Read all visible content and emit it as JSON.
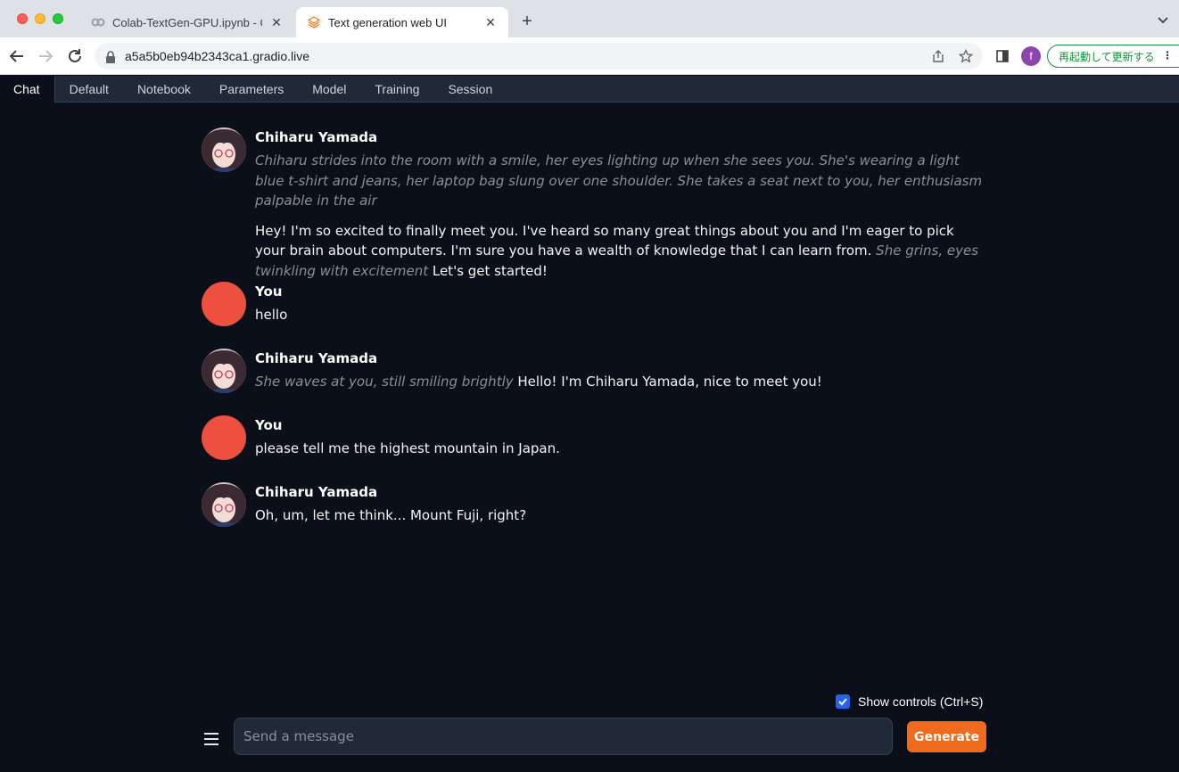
{
  "browser": {
    "tabs": [
      {
        "title": "Colab-TextGen-GPU.ipynb - C",
        "icon": "colab-icon"
      },
      {
        "title": "Text generation web UI",
        "icon": "gradio-icon"
      }
    ],
    "url": "a5a5b0eb94b2343ca1.gradio.live",
    "profile_initial": "f",
    "update_label": "再起動して更新する"
  },
  "app": {
    "tabs": [
      "Chat",
      "Default",
      "Notebook",
      "Parameters",
      "Model",
      "Training",
      "Session"
    ],
    "active_tab": "Chat"
  },
  "chat": {
    "messages": [
      {
        "sender": "Chiharu Yamada",
        "role": "bot",
        "action": "Chiharu strides into the room with a smile, her eyes lighting up when she sees you. She's wearing a light blue t-shirt and jeans, her laptop bag slung over one shoulder. She takes a seat next to you, her enthusiasm palpable in the air",
        "text_a": "Hey! I'm so excited to finally meet you. I've heard so many great things about you and I'm eager to pick your brain about computers. I'm sure you have a wealth of knowledge that I can learn from. ",
        "text_action": "She grins, eyes twinkling with excitement",
        "text_b": " Let's get started!"
      },
      {
        "sender": "You",
        "role": "user",
        "text": "hello"
      },
      {
        "sender": "Chiharu Yamada",
        "role": "bot",
        "action": "She waves at you, still smiling brightly",
        "text": " Hello! I'm Chiharu Yamada, nice to meet you!"
      },
      {
        "sender": "You",
        "role": "user",
        "text": "please tell me the highest mountain in Japan."
      },
      {
        "sender": "Chiharu Yamada",
        "role": "bot",
        "text": "Oh, um, let me think... Mount Fuji, right?"
      }
    ]
  },
  "controls": {
    "show_controls_label": "Show controls (Ctrl+S)",
    "show_controls_checked": true,
    "input_placeholder": "Send a message",
    "input_value": "",
    "generate_label": "Generate"
  },
  "colors": {
    "background": "#0b0f19",
    "generate": "#f26a1b",
    "user_avatar": "#ee5040",
    "checkbox": "#2563eb"
  }
}
